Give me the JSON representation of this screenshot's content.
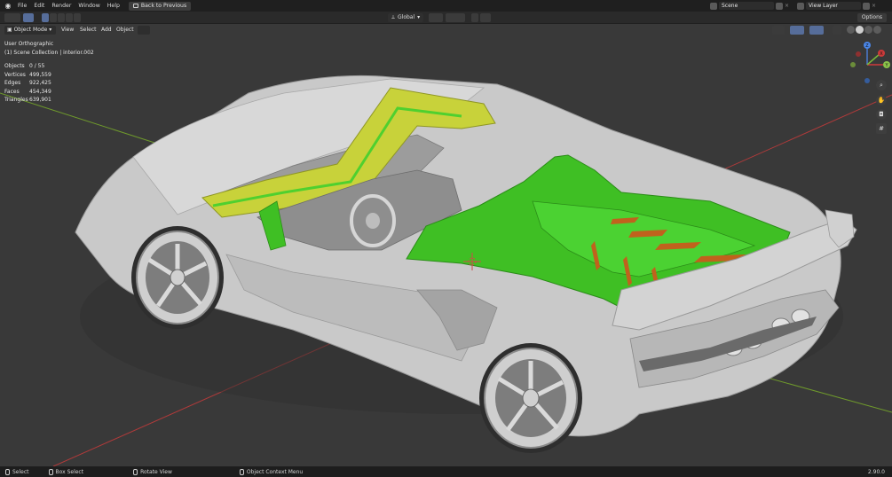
{
  "menu": {
    "items": [
      "File",
      "Edit",
      "Render",
      "Window",
      "Help"
    ],
    "back_label": "Back to Previous"
  },
  "scene": {
    "scene_name": "Scene",
    "view_layer": "View Layer"
  },
  "toolbar": {
    "transform_orientation": "Global",
    "options_label": "Options"
  },
  "viewport_header": {
    "mode": "Object Mode",
    "view": "View",
    "select": "Select",
    "add": "Add",
    "object": "Object"
  },
  "overlay": {
    "view_name": "User Orthographic",
    "collection": "(1) Scene Collection | interior.002"
  },
  "stats": [
    {
      "label": "Objects",
      "value": "0 / 55"
    },
    {
      "label": "Vertices",
      "value": "499,559"
    },
    {
      "label": "Edges",
      "value": "922,425"
    },
    {
      "label": "Faces",
      "value": "454,349"
    },
    {
      "label": "Triangles",
      "value": "639,901"
    }
  ],
  "gizmo": {
    "z_label": "Z",
    "y_label": "Y",
    "x_label": "X"
  },
  "statusbar": {
    "select": "Select",
    "box_select": "Box Select",
    "rotate_view": "Rotate View",
    "context_menu": "Object Context Menu",
    "version": "2.90.0"
  },
  "colors": {
    "selection_green": "#3fbf24",
    "selection_yellow": "#c8d23a",
    "car_body": "#c9c9c9",
    "x_axis": "#b03a3a",
    "y_axis": "#6f9a2c"
  }
}
